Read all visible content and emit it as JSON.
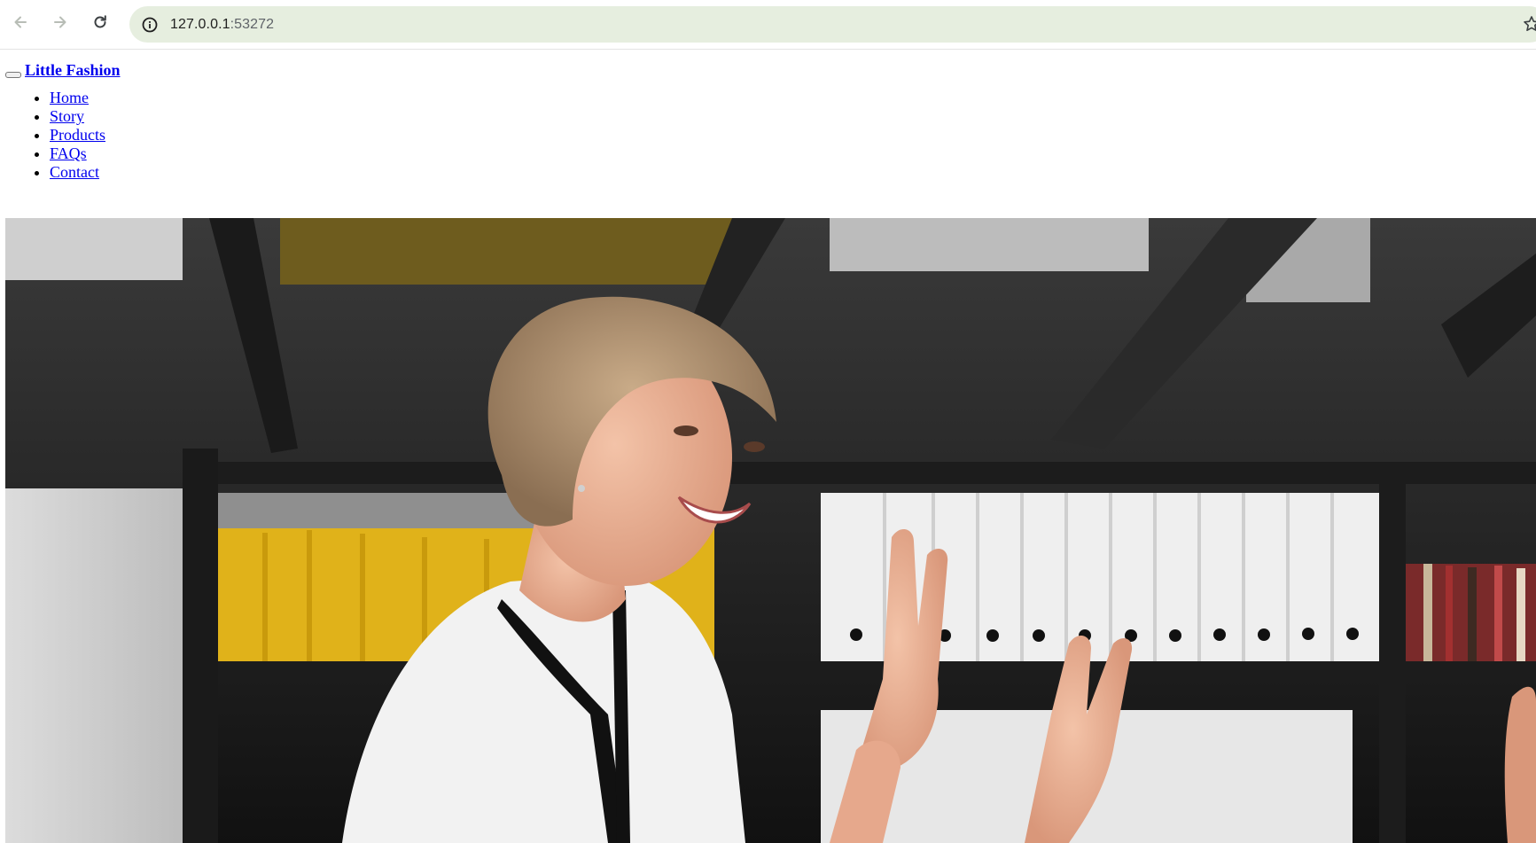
{
  "browser": {
    "url_host": "127.0.0.1",
    "url_port": ":53272",
    "icons": {
      "back": "arrow-left-icon",
      "forward": "arrow-right-icon",
      "reload": "reload-icon",
      "site_info": "info-icon",
      "bookmark": "star-icon"
    },
    "omnibox_color": "#e6eedf"
  },
  "navbar": {
    "brand": "Little Fashion",
    "items": [
      {
        "label": "Home"
      },
      {
        "label": "Story"
      },
      {
        "label": "Products"
      },
      {
        "label": "FAQs"
      },
      {
        "label": "Contact"
      }
    ],
    "link_color": "#0000ee"
  },
  "hero": {
    "image": "woman-high-five-office-photo"
  }
}
